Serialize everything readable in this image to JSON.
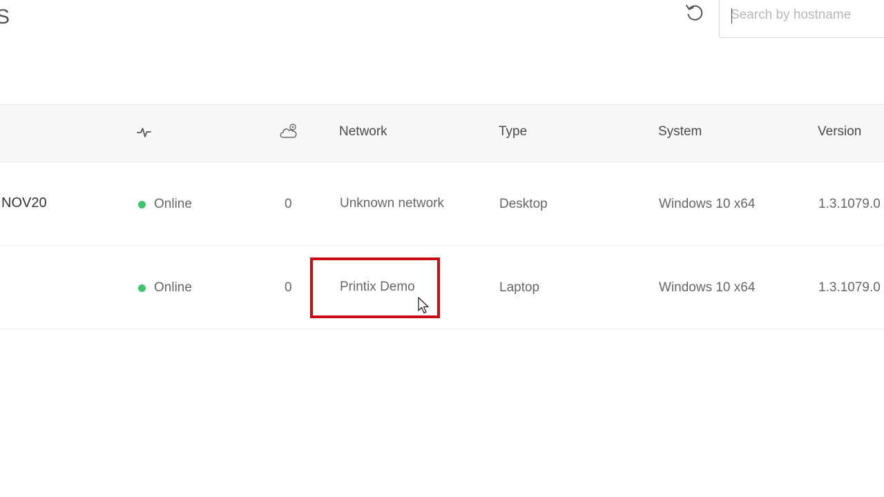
{
  "header": {
    "title_fragment": "S",
    "refresh_icon": "refresh-icon",
    "search": {
      "placeholder": "Search by hostname",
      "value": ""
    }
  },
  "table": {
    "columns": {
      "activity_icon": "activity-icon",
      "cloud_icon": "cloud-settings-icon",
      "network": "Network",
      "type": "Type",
      "system": "System",
      "version": "Version"
    },
    "rows": [
      {
        "name": "NOV20",
        "status": "Online",
        "count": "0",
        "network": "Unknown network",
        "type": "Desktop",
        "system": "Windows 10 x64",
        "version": "1.3.1079.0"
      },
      {
        "name": "",
        "status": "Online",
        "count": "0",
        "network": "Printix Demo",
        "type": "Laptop",
        "system": "Windows 10 x64",
        "version": "1.3.1079.0"
      }
    ]
  },
  "colors": {
    "online": "#3ec46d",
    "highlight": "#cc0a13"
  }
}
